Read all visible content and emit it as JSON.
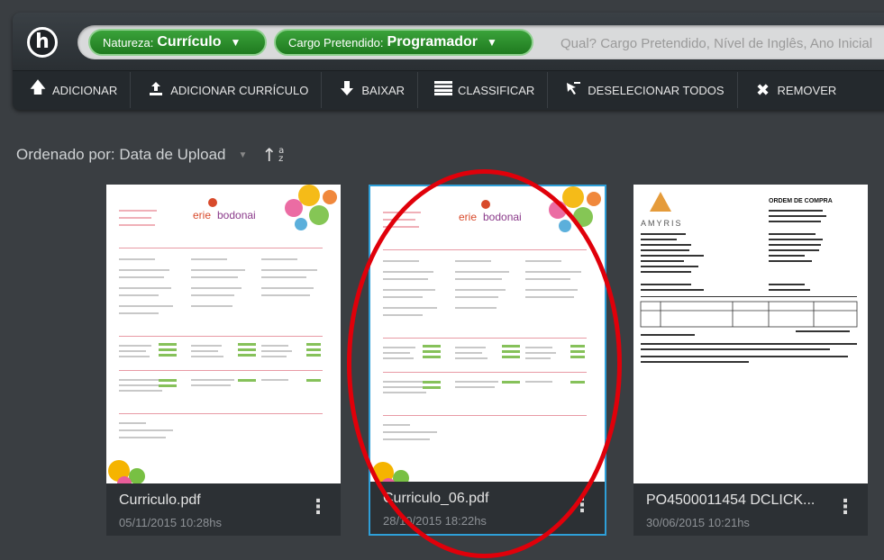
{
  "app": {
    "logo_letter": "h"
  },
  "search": {
    "chips": [
      {
        "label": "Natureza:",
        "value": "Currículo"
      },
      {
        "label": "Cargo Pretendido:",
        "value": "Programador"
      }
    ],
    "placeholder": "Qual? Cargo Pretendido, Nível de Inglês, Ano Inicial"
  },
  "actions": [
    {
      "label": "ADICIONAR",
      "icon": "arrow-up-icon"
    },
    {
      "label": "ADICIONAR CURRÍCULO",
      "icon": "upload-icon"
    },
    {
      "label": "BAIXAR",
      "icon": "download-icon"
    },
    {
      "label": "CLASSIFICAR",
      "icon": "list-icon"
    },
    {
      "label": "DESELECIONAR TODOS",
      "icon": "cursor-icon"
    },
    {
      "label": "REMOVER",
      "icon": "close-icon"
    }
  ],
  "sort": {
    "label": "Ordenado por: Data de Upload",
    "az_top": "a",
    "az_bottom": "z"
  },
  "files": [
    {
      "name": "Curriculo.pdf",
      "date": "05/11/2015 10:28hs",
      "selected": false
    },
    {
      "name": "Curriculo_06.pdf",
      "date": "28/10/2015 18:22hs",
      "selected": true
    },
    {
      "name": "PO4500011454 DCLICK...",
      "date": "30/06/2015 10:21hs",
      "selected": false
    }
  ],
  "thumbs": {
    "resume_logo_a": "erie",
    "resume_logo_b": "bodonai",
    "po_logo": "AMYRIS",
    "po_title": "ORDEM DE COMPRA"
  },
  "colors": {
    "accent_green": "#2a8f2a",
    "selection_blue": "#2e9fd8",
    "annotation_red": "#e0000a",
    "background": "#3a3e42"
  }
}
